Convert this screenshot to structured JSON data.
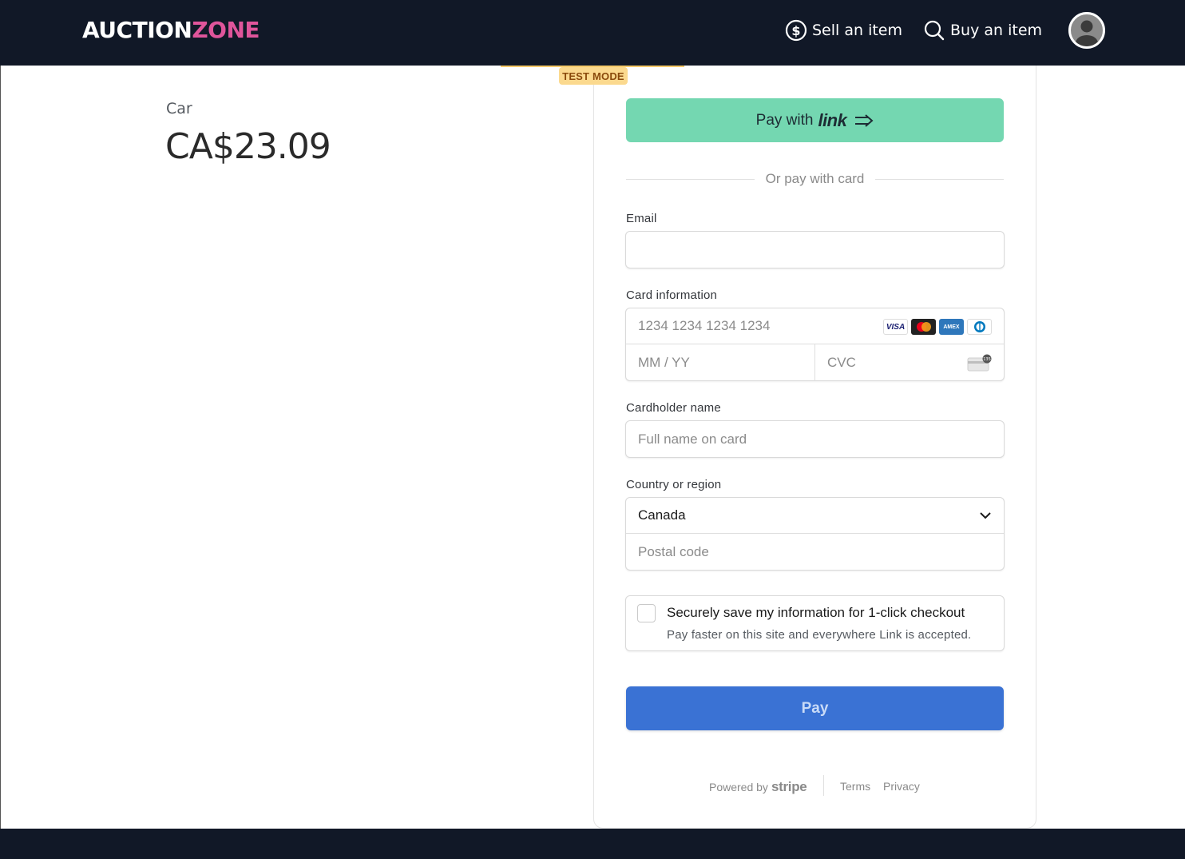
{
  "header": {
    "logo_part1": "AUCTION",
    "logo_part2": "ZONE",
    "sell_label": "Sell an item",
    "buy_label": "Buy an item",
    "sell_icon": "dollar-circle-icon",
    "buy_icon": "search-icon",
    "avatar_icon": "user-avatar-icon"
  },
  "product": {
    "name": "Car",
    "price": "CA$23.09"
  },
  "checkout": {
    "test_mode": "TEST MODE",
    "link_button_prefix": "Pay with",
    "link_button_brand": "link",
    "divider_text": "Or pay with card",
    "email_label": "Email",
    "email_value": "",
    "card_label": "Card information",
    "card_number_placeholder": "1234 1234 1234 1234",
    "card_expiry_placeholder": "MM / YY",
    "card_cvc_placeholder": "CVC",
    "card_brands": [
      "VISA",
      "Mastercard",
      "AMEX",
      "Diners"
    ],
    "cardholder_label": "Cardholder name",
    "cardholder_placeholder": "Full name on card",
    "country_label": "Country or region",
    "country_value": "Canada",
    "postal_placeholder": "Postal code",
    "save_title": "Securely save my information for 1-click checkout",
    "save_subtitle": "Pay faster on this site and everywhere Link is accepted.",
    "pay_label": "Pay"
  },
  "footer": {
    "powered_by": "Powered by",
    "stripe": "stripe",
    "terms": "Terms",
    "privacy": "Privacy"
  },
  "colors": {
    "header_bg": "#111827",
    "brand_pink": "#e0559b",
    "link_green": "#74d7b1",
    "pay_blue": "#3a72d4",
    "test_mode_bg": "#fbd98e"
  }
}
